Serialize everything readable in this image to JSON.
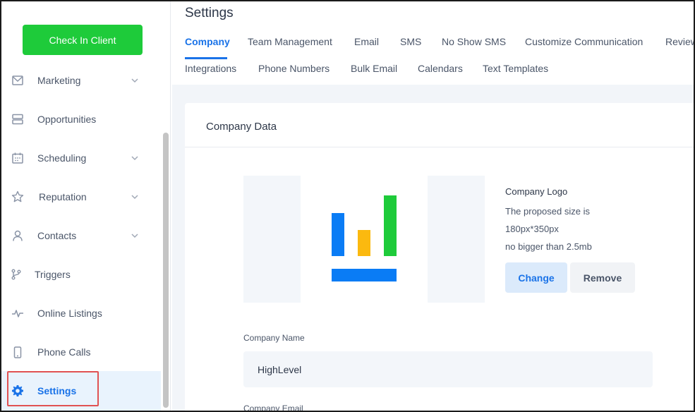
{
  "sidebar": {
    "checkin_label": "Check In Client",
    "items": [
      {
        "label": "Marketing",
        "icon": "mail-icon",
        "has_chevron": true
      },
      {
        "label": "Opportunities",
        "icon": "stack-icon",
        "has_chevron": false
      },
      {
        "label": "Scheduling",
        "icon": "calendar-icon",
        "has_chevron": true
      },
      {
        "label": "Reputation",
        "icon": "star-icon",
        "has_chevron": true
      },
      {
        "label": "Contacts",
        "icon": "user-icon",
        "has_chevron": true
      },
      {
        "label": "Triggers",
        "icon": "branch-icon",
        "has_chevron": false
      },
      {
        "label": "Online Listings",
        "icon": "pulse-icon",
        "has_chevron": false
      },
      {
        "label": "Phone Calls",
        "icon": "phone-icon",
        "has_chevron": false
      },
      {
        "label": "Settings",
        "icon": "gear-icon",
        "has_chevron": false,
        "active": true
      }
    ]
  },
  "header": {
    "title": "Settings",
    "tabs_row1": [
      "Company",
      "Team Management",
      "Email",
      "SMS",
      "No Show SMS",
      "Customize Communication",
      "Review"
    ],
    "tabs_row2": [
      "Integrations",
      "Phone Numbers",
      "Bulk Email",
      "Calendars",
      "Text Templates"
    ],
    "active_tab": "Company"
  },
  "company_card": {
    "title": "Company Data",
    "logo_heading": "Company Logo",
    "logo_line1": "The proposed size is",
    "logo_line2": "180px*350px",
    "logo_line3": "no bigger than 2.5mb",
    "change_label": "Change",
    "remove_label": "Remove",
    "name_label": "Company Name",
    "name_value": "HighLevel",
    "email_label": "Company Email"
  },
  "colors": {
    "accent": "#1a73e8",
    "checkin_green": "#1ecb3a",
    "logo_blue": "#0a7cf5",
    "logo_yellow": "#fbb90f",
    "logo_green": "#1ecb3a",
    "highlight_red": "#e05252"
  }
}
